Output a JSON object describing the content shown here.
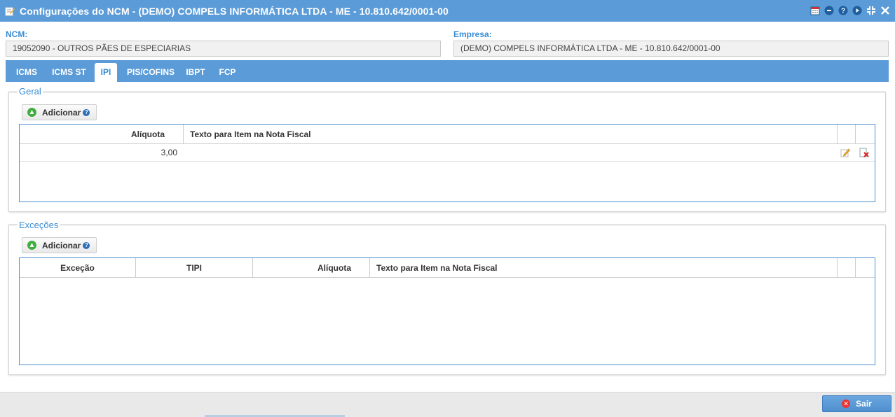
{
  "window": {
    "title": "Configurações do NCM - (DEMO) COMPELS INFORMÁTICA LTDA - ME - 10.810.642/0001-00",
    "icons": [
      "edit-document-icon",
      "calendar-icon",
      "circle-minus-icon",
      "help-icon",
      "play-icon",
      "collapse-icon",
      "close-icon"
    ]
  },
  "fields": {
    "ncm_label": "NCM:",
    "ncm_value": "19052090 - OUTROS PÃES DE ESPECIARIAS",
    "empresa_label": "Empresa:",
    "empresa_value": "(DEMO) COMPELS INFORMÁTICA LTDA - ME - 10.810.642/0001-00"
  },
  "tabs": [
    {
      "label": "ICMS",
      "active": false
    },
    {
      "label": "ICMS ST",
      "active": false
    },
    {
      "label": "IPI",
      "active": true
    },
    {
      "label": "PIS/COFINS",
      "active": false
    },
    {
      "label": "IBPT",
      "active": false
    },
    {
      "label": "FCP",
      "active": false
    }
  ],
  "geral": {
    "legend": "Geral",
    "add_label": "Adicionar",
    "columns": [
      "Alíquota",
      "Texto para Item na Nota Fiscal"
    ],
    "rows": [
      {
        "aliquota": "3,00",
        "texto": ""
      }
    ]
  },
  "excecoes": {
    "legend": "Exceções",
    "add_label": "Adicionar",
    "columns": [
      "Exceção",
      "TIPI",
      "Alíquota",
      "Texto para Item na Nota Fiscal"
    ],
    "rows": []
  },
  "footer": {
    "sair_label": "Sair"
  },
  "colors": {
    "accent": "#5b9bd8",
    "label_blue": "#3b8dd3",
    "grid_border": "#4d8fcf"
  }
}
